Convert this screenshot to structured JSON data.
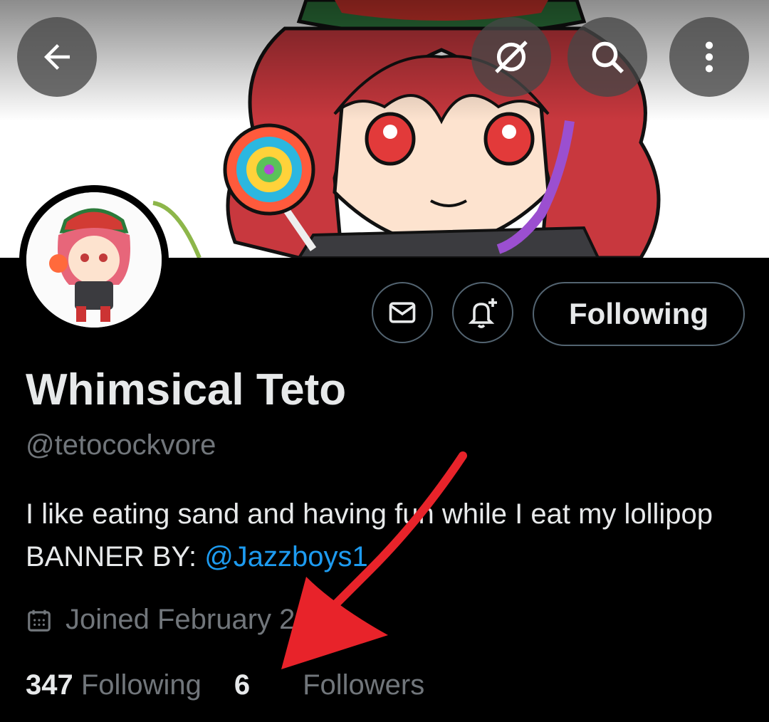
{
  "header": {
    "back_icon": "arrow-left-icon",
    "grok_icon": "grok-slash-icon",
    "search_icon": "search-icon",
    "more_icon": "more-vertical-icon"
  },
  "profile": {
    "display_name": "Whimsical Teto",
    "handle": "@tetocockvore",
    "bio_text": "I like eating sand and having fun while I eat my lollipop  BANNER BY: ",
    "bio_mention": "@Jazzboys1",
    "joined": "Joined February 2025",
    "following_count": "347",
    "following_label": "Following",
    "followers_count": "6",
    "followers_label": "Followers"
  },
  "actions": {
    "message_icon": "envelope-icon",
    "notify_icon": "bell-plus-icon",
    "following_button": "Following"
  },
  "colors": {
    "background": "#000000",
    "text": "#e7e9ea",
    "muted": "#71767b",
    "link": "#1d9bf0",
    "annotation_arrow": "#e8232a"
  }
}
